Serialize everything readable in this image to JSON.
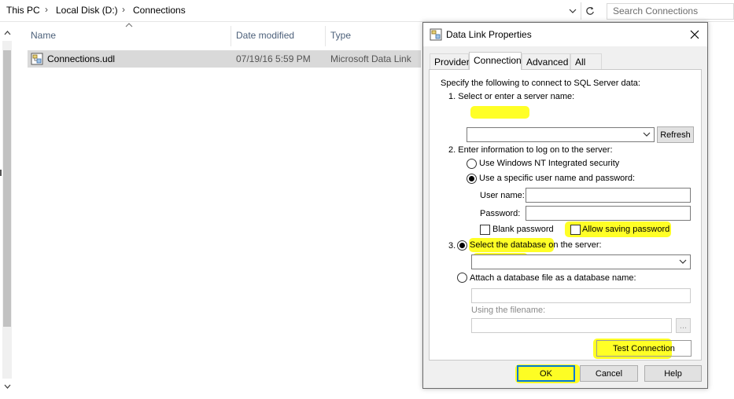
{
  "explorer": {
    "breadcrumb": [
      "This PC",
      "Local Disk (D:)",
      "Connections"
    ],
    "search_placeholder": "Search Connections",
    "columns": {
      "name": "Name",
      "date": "Date modified",
      "type": "Type"
    },
    "files": [
      {
        "name": "Connections.udl",
        "date": "07/19/16 5:59 PM",
        "type": "Microsoft Data Link"
      }
    ]
  },
  "dialog": {
    "title": "Data Link Properties",
    "tabs": [
      "Provider",
      "Connection",
      "Advanced",
      "All"
    ],
    "active_tab": "Connection",
    "intro": "Specify the following to connect to SQL Server data:",
    "step1": "1. Select or enter a server name:",
    "server_value": "",
    "refresh_label": "Refresh",
    "step2": "2. Enter information to log on to the server:",
    "auth_windows": "Use Windows NT Integrated security",
    "auth_specific": "Use a specific user name and password:",
    "auth_selected": "specific",
    "user_label": "User name:",
    "user_value": "",
    "password_label": "Password:",
    "password_value": "",
    "blank_password": "Blank password",
    "allow_saving": "Allow saving password",
    "step3": "3.",
    "select_db": "Select the database on the server:",
    "database_value": "",
    "attach_db": "Attach a database file as a database name:",
    "using_filename": "Using the filename:",
    "browse_label": "...",
    "test_connection": "Test Connection",
    "ok": "OK",
    "cancel": "Cancel",
    "help": "Help",
    "highlight_color": "#ffff00"
  }
}
